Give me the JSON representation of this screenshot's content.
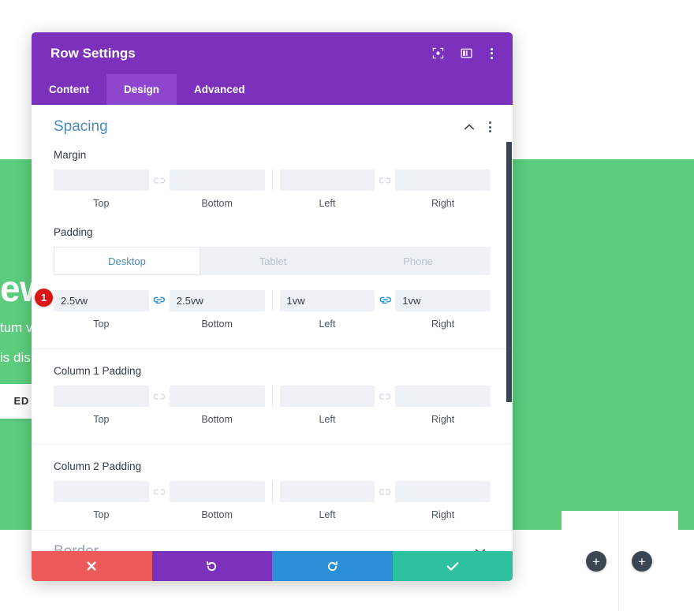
{
  "background": {
    "heading_fragment": "ew",
    "paragraph_fragment_1": "tum v",
    "paragraph_fragment_2": "is dis",
    "button_fragment": "ED",
    "green_hex": "#5bcd7d",
    "add_button_1": "+",
    "add_button_2": "+"
  },
  "modal": {
    "title": "Row Settings",
    "header_icons": [
      {
        "name": "focus-icon"
      },
      {
        "name": "layout-icon"
      },
      {
        "name": "kebab-menu-icon"
      }
    ],
    "tabs": [
      {
        "label": "Content",
        "active": false
      },
      {
        "label": "Design",
        "active": true
      },
      {
        "label": "Advanced",
        "active": false
      }
    ],
    "sections": [
      {
        "title": "Spacing",
        "open": true,
        "collapse_icon": "chevron-up-icon",
        "menu_icon": "kebab-menu-icon"
      },
      {
        "title": "Border",
        "open": false,
        "collapse_icon": "chevron-down-icon"
      }
    ],
    "margin": {
      "label": "Margin",
      "fields": [
        {
          "label": "Top",
          "value": "",
          "placeholder": ""
        },
        {
          "label": "Bottom",
          "value": "",
          "placeholder": ""
        },
        {
          "label": "Left",
          "value": "",
          "placeholder": ""
        },
        {
          "label": "Right",
          "value": "",
          "placeholder": ""
        }
      ],
      "link_left": {
        "icon": "unlink-icon",
        "active": false
      },
      "link_right": {
        "icon": "unlink-icon",
        "active": false
      }
    },
    "padding": {
      "label": "Padding",
      "device_tabs": [
        {
          "label": "Desktop",
          "active": true
        },
        {
          "label": "Tablet",
          "active": false
        },
        {
          "label": "Phone",
          "active": false
        }
      ],
      "badge": "1",
      "fields": [
        {
          "label": "Top",
          "value": "2.5vw"
        },
        {
          "label": "Bottom",
          "value": "2.5vw"
        },
        {
          "label": "Left",
          "value": "1vw"
        },
        {
          "label": "Right",
          "value": "1vw"
        }
      ],
      "link_left": {
        "icon": "link-icon",
        "active": true
      },
      "link_right": {
        "icon": "link-icon",
        "active": true
      }
    },
    "column1_padding": {
      "label": "Column 1 Padding",
      "fields": [
        {
          "label": "Top",
          "value": ""
        },
        {
          "label": "Bottom",
          "value": ""
        },
        {
          "label": "Left",
          "value": ""
        },
        {
          "label": "Right",
          "value": ""
        }
      ],
      "link_left": {
        "icon": "unlink-icon",
        "active": false
      },
      "link_right": {
        "icon": "unlink-icon",
        "active": false
      }
    },
    "column2_padding": {
      "label": "Column 2 Padding",
      "fields": [
        {
          "label": "Top",
          "value": ""
        },
        {
          "label": "Bottom",
          "value": ""
        },
        {
          "label": "Left",
          "value": ""
        },
        {
          "label": "Right",
          "value": ""
        }
      ],
      "link_left": {
        "icon": "unlink-icon",
        "active": false
      },
      "link_right": {
        "icon": "unlink-icon",
        "active": false
      }
    },
    "footer_buttons": [
      {
        "name": "cancel-button",
        "icon": "close-icon",
        "color": "#ed5a5a"
      },
      {
        "name": "undo-button",
        "icon": "undo-icon",
        "color": "#7c31bd"
      },
      {
        "name": "redo-button",
        "icon": "redo-icon",
        "color": "#2a8fd4"
      },
      {
        "name": "save-button",
        "icon": "check-icon",
        "color": "#2ec1a0"
      }
    ],
    "accent_hex": "#7c31bd",
    "badge_hex": "#d81616"
  }
}
